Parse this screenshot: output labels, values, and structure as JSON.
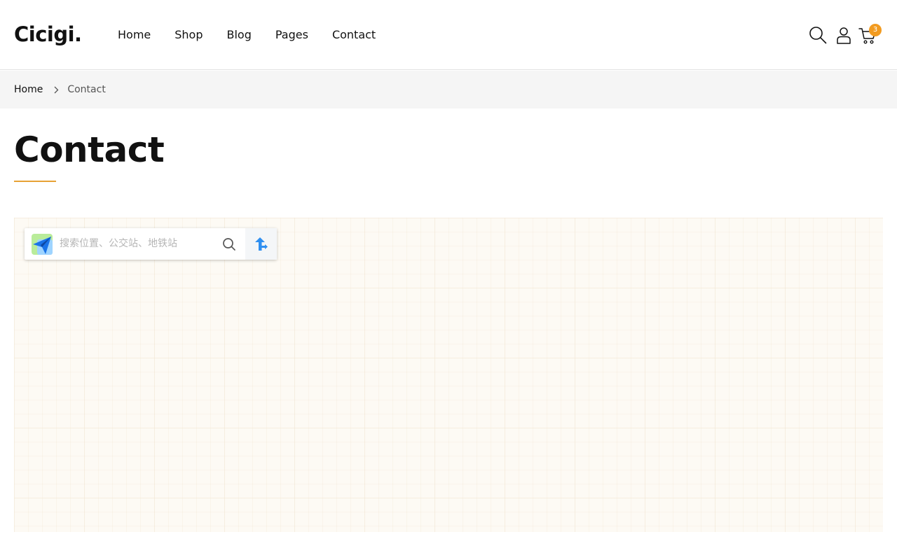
{
  "header": {
    "logo": "Cicigi.",
    "nav": [
      "Home",
      "Shop",
      "Blog",
      "Pages",
      "Contact"
    ],
    "cart_count": "3",
    "accent_color": "#f29b20"
  },
  "breadcrumb": {
    "home": "Home",
    "current": "Contact"
  },
  "page": {
    "title": "Contact",
    "underline_color": "#e7a235"
  },
  "map": {
    "search_placeholder": "搜索位置、公交站、地铁站",
    "icons": [
      "map-logo-icon",
      "search-icon",
      "route-icon"
    ]
  }
}
